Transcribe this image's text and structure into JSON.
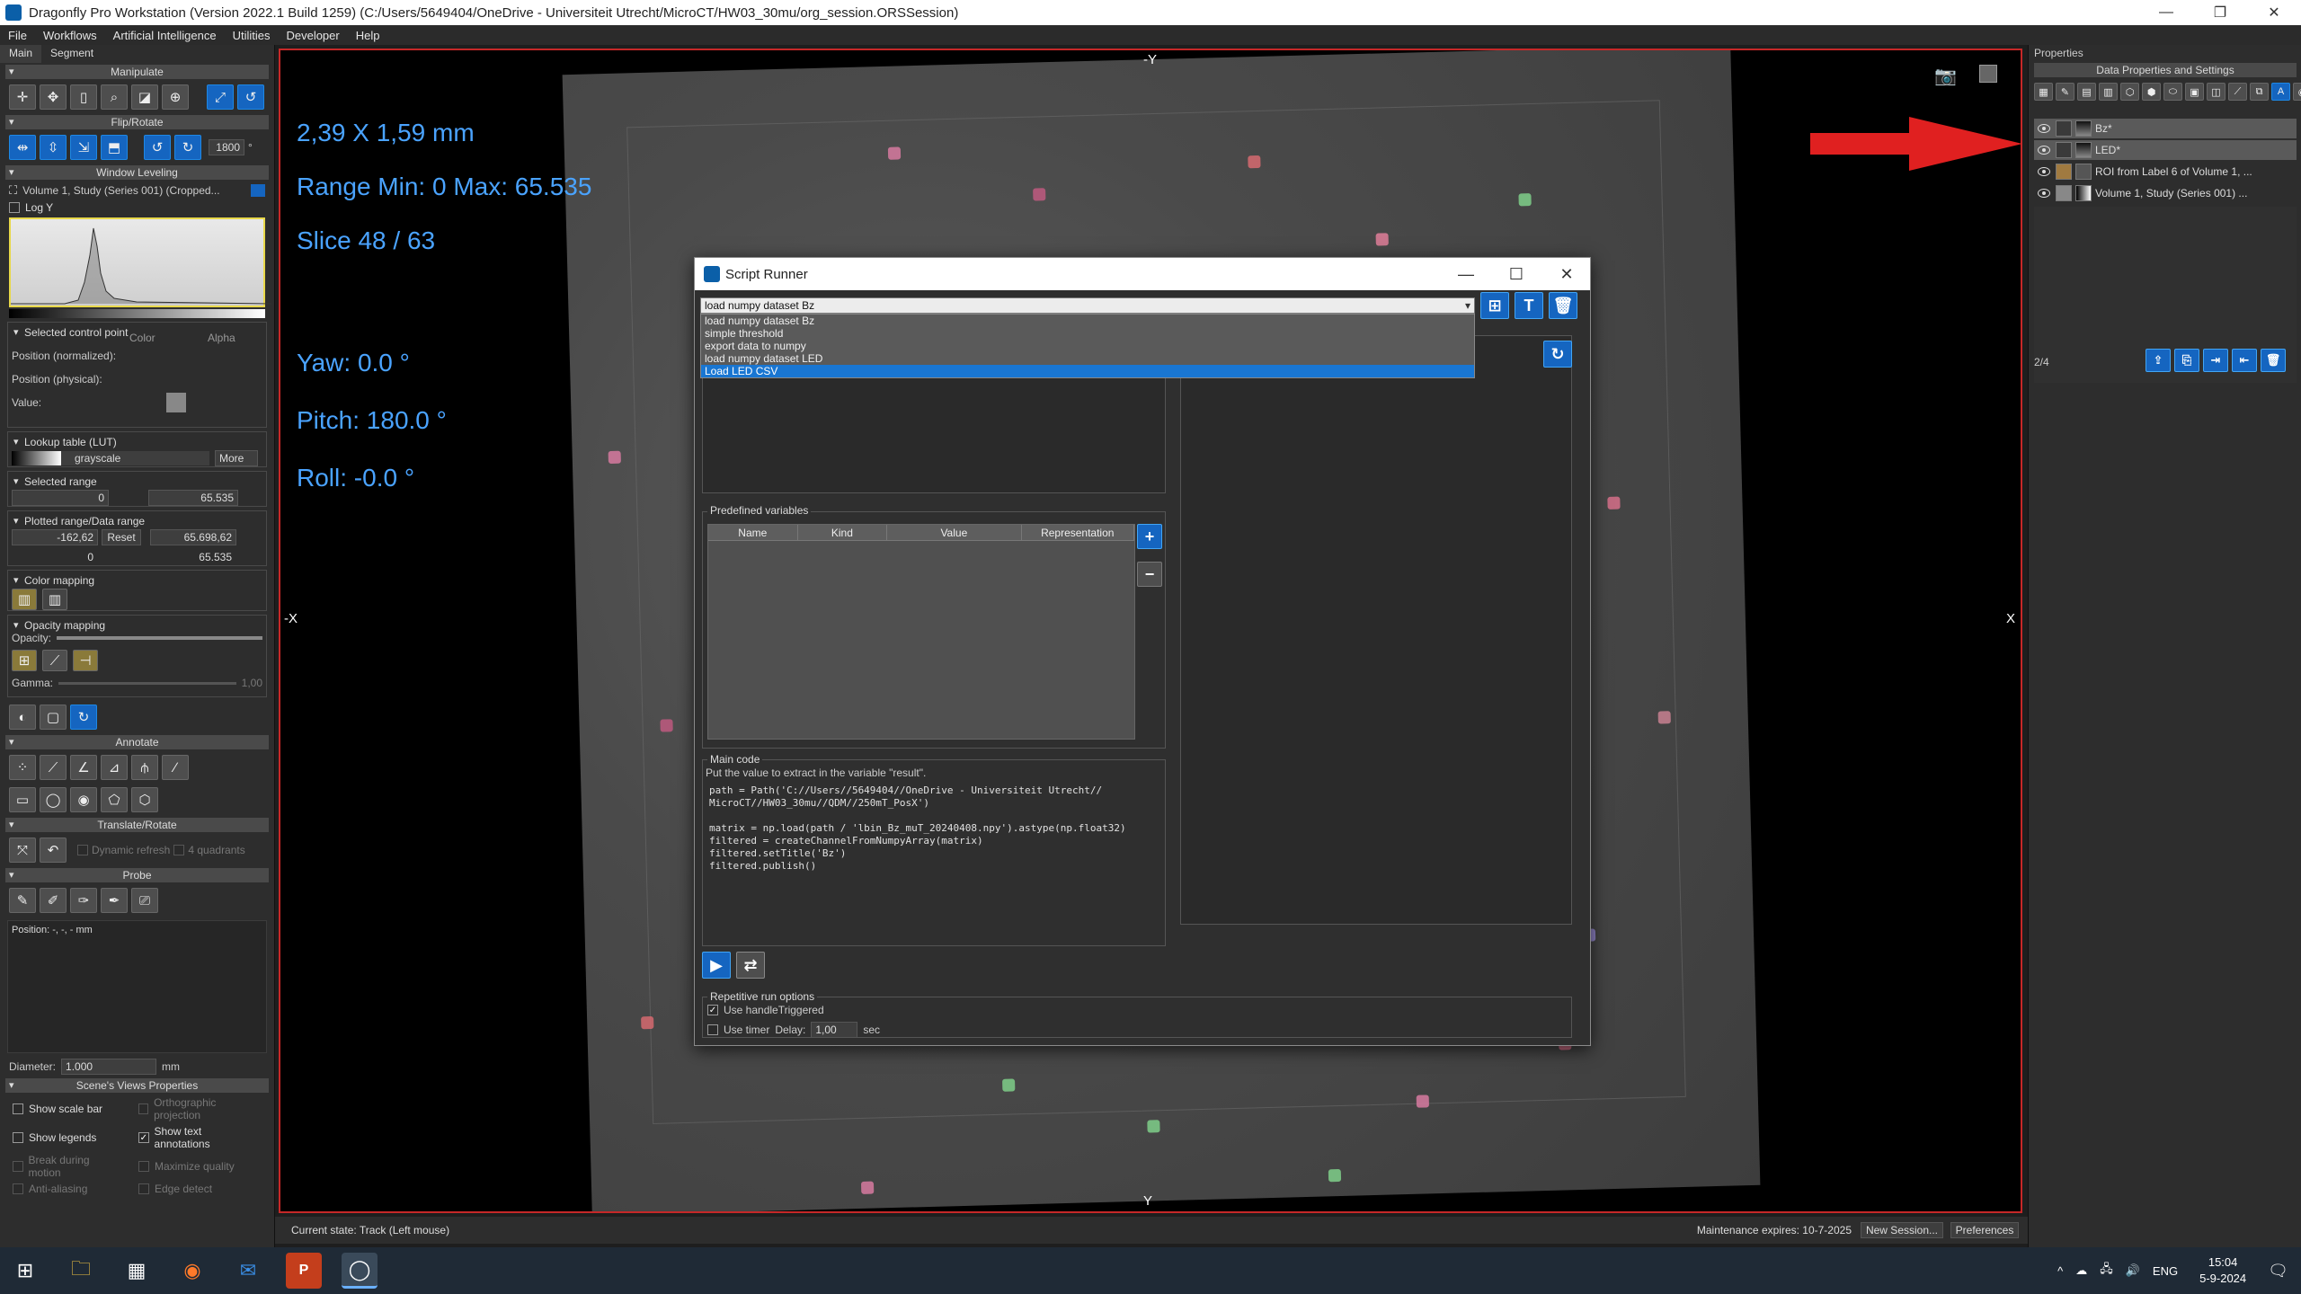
{
  "window": {
    "title": "Dragonfly Pro Workstation (Version 2022.1 Build 1259) (C:/Users/5649404/OneDrive - Universiteit Utrecht/MicroCT/HW03_30mu/org_session.ORSSession)"
  },
  "menu": [
    "File",
    "Workflows",
    "Artificial Intelligence",
    "Utilities",
    "Developer",
    "Help"
  ],
  "left": {
    "tabs": [
      "Main",
      "Segment"
    ],
    "sections": {
      "manipulate": "Manipulate",
      "flip_rotate": "Flip/Rotate",
      "window_leveling": "Window Leveling",
      "annotate": "Annotate",
      "translate_rotate": "Translate/Rotate",
      "probe": "Probe",
      "scene_views": "Scene's Views Properties"
    },
    "rotate_value": "1800",
    "rotate_unit": "°",
    "volume_name": "Volume 1, Study  (Series 001) (Cropped...",
    "log_y": "Log Y",
    "selected_control_point": "Selected control point",
    "color_label": "Color",
    "alpha_label": "Alpha",
    "pos_normalized": "Position (normalized):",
    "pos_physical": "Position (physical):",
    "value_label": "Value:",
    "lut_title": "Lookup table (LUT)",
    "lut_value": "grayscale",
    "lut_more": "More",
    "selected_range": "Selected range",
    "sel_min": "0",
    "sel_max": "65.535",
    "plotted_range": "Plotted range/Data range",
    "plot_min": "-162,62",
    "reset": "Reset",
    "plot_max": "65.698,62",
    "data_min": "0",
    "data_max": "65.535",
    "color_mapping": "Color mapping",
    "opacity_mapping": "Opacity mapping",
    "opacity": "Opacity:",
    "gamma": "Gamma:",
    "gamma_value": "1,00",
    "dynamic_refresh": "Dynamic refresh",
    "quadrants": "4 quadrants",
    "position_readout": "Position: -, -, - mm",
    "diameter_label": "Diameter:",
    "diameter_value": "1.000",
    "diameter_unit": "mm",
    "scene": {
      "show_scale_bar": "Show scale bar",
      "ortho": "Orthographic projection",
      "show_legends": "Show legends",
      "show_text_annotations": "Show text annotations",
      "break_motion": "Break during motion",
      "maximize_quality": "Maximize quality",
      "anti_aliasing": "Anti-aliasing",
      "edge_detect": "Edge detect"
    }
  },
  "viewer": {
    "size_text": "2,39 X 1,59 mm",
    "range_text": "Range Min: 0 Max: 65.535",
    "slice_text": "Slice 48 / 63",
    "yaw": "Yaw: 0.0 °",
    "pitch": "Pitch: 180.0 °",
    "roll": "Roll: -0.0 °",
    "axis_top": "-Y",
    "axis_bottom": "Y",
    "axis_left": "-X",
    "axis_right": "X"
  },
  "dialog": {
    "title": "Script Runner",
    "selected_script": "load numpy dataset Bz",
    "scripts": [
      "load numpy dataset Bz",
      "simple threshold",
      "export data to numpy",
      "load numpy dataset LED",
      "Load LED CSV"
    ],
    "predefined_variables": "Predefined variables",
    "columns": [
      "Name",
      "Kind",
      "Value",
      "Representation"
    ],
    "main_code_label": "Main code",
    "hint": "Put the value to extract in the variable \"result\".",
    "code": "path = Path('C://Users//5649404//OneDrive - Universiteit Utrecht//\nMicroCT//HW03_30mu//QDM//250mT_PosX')\n\nmatrix = np.load(path / 'lbin_Bz_muT_20240408.npy').astype(np.float32)\nfiltered = createChannelFromNumpyArray(matrix)\nfiltered.setTitle('Bz')\nfiltered.publish()",
    "repetitive_label": "Repetitive run options",
    "use_handle": "Use handleTriggered",
    "use_timer": "Use timer",
    "delay_label": "Delay:",
    "delay_value": "1,00",
    "sec": "sec"
  },
  "right": {
    "header": "Properties",
    "subheader": "Data Properties and Settings",
    "rows": [
      "Bz*",
      "LED*",
      "ROI from Label 6 of Volume 1, ...",
      "Volume 1, Study  (Series 001) ..."
    ],
    "counter": "2/4"
  },
  "status": {
    "current_state": "Current state: Track (Left mouse)",
    "maintenance": "Maintenance expires: 10-7-2025",
    "new_session": "New Session...",
    "preferences": "Preferences"
  },
  "taskbar": {
    "lang": "ENG",
    "time": "15:04",
    "date": "5-9-2024"
  },
  "colors": {
    "accent": "#1565c0",
    "overlay_text": "#4aa3ff",
    "viewer_border": "#c62828",
    "arrow": "#e02020"
  }
}
